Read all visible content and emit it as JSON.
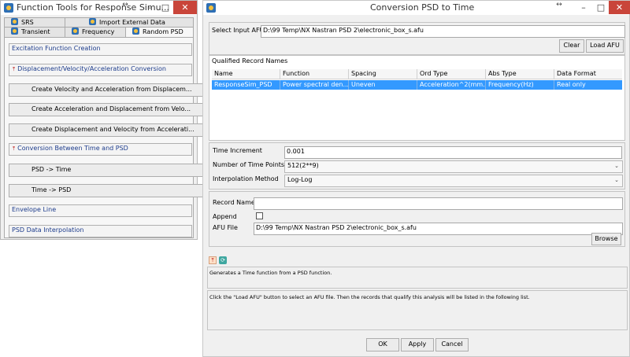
{
  "left_window": {
    "title": "Function Tools for Response Simu...",
    "tabs_row1": [
      {
        "label": "SRS"
      },
      {
        "label": "Import External Data"
      }
    ],
    "tabs_row2": [
      {
        "label": "Transient"
      },
      {
        "label": "Frequency"
      },
      {
        "label": "Random PSD"
      }
    ],
    "sections": [
      {
        "label": "Excitation Function Creation"
      },
      {
        "label": "Displacement/Velocity/Acceleration Conversion"
      },
      {
        "label": "Conversion Between Time and PSD"
      },
      {
        "label": "Envelope Line"
      },
      {
        "label": "PSD Data Interpolation"
      }
    ],
    "conversion_buttons": [
      {
        "label": "Create Velocity and Acceleration from Displacem..."
      },
      {
        "label": "Create Acceleration and Displacement from Velo..."
      },
      {
        "label": "Create Displacement and Velocity from Accelerati..."
      }
    ],
    "time_psd_buttons": [
      {
        "label": "PSD -> Time"
      },
      {
        "label": "Time -> PSD"
      }
    ]
  },
  "dialog": {
    "title": "Conversion PSD to Time",
    "select_input_label": "Select Input AFU",
    "select_input_value": "D:\\99 Temp\\NX Nastran PSD 2\\electronic_box_s.afu",
    "clear_label": "Clear",
    "load_afu_label": "Load AFU",
    "qualified_title": "Qualified Record Names",
    "columns": [
      "Name",
      "Function",
      "Spacing",
      "Ord Type",
      "Abs Type",
      "Data Format"
    ],
    "rows": [
      {
        "cells": [
          "ResponseSim_PSD",
          "Power spectral den...",
          "Uneven",
          "Acceleration^2(mm...",
          "Frequency(Hz)",
          "Real only"
        ]
      }
    ],
    "time_increment_label": "Time Increment",
    "time_increment_value": "0.001",
    "num_points_label": "Number of Time Points",
    "num_points_value": "512(2**9)",
    "interp_label": "Interpolation Method",
    "interp_value": "Log-Log",
    "record_name_label": "Record Name",
    "record_name_value": "",
    "append_label": "Append",
    "afu_file_label": "AFU File",
    "afu_file_value": "D:\\99 Temp\\NX Nastran PSD 2\\electronic_box_s.afu",
    "browse_label": "Browse",
    "info_text": "Generates a Time function from a PSD function.",
    "hint_text": "Click the \"Load AFU\" button to select an AFU file. Then the records that qualify this analysis will be listed in the following list.",
    "ok_label": "OK",
    "apply_label": "Apply",
    "cancel_label": "Cancel"
  },
  "colors": {
    "selection": "#3399ff",
    "section_text": "#1d3c8c",
    "close_red": "#c9453a"
  }
}
